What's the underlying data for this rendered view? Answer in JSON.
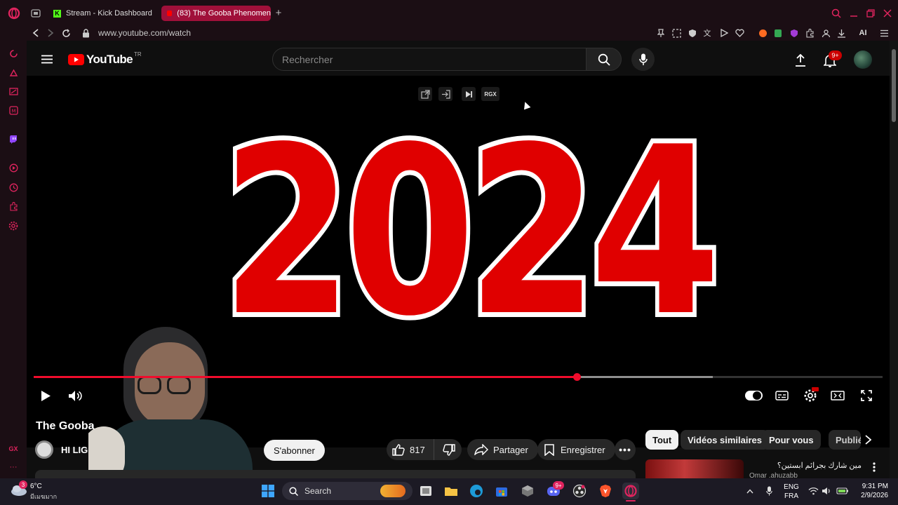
{
  "browser": {
    "tabs": [
      {
        "label": "Stream - Kick Dashboard",
        "active": false
      },
      {
        "label": "(83) The Gooba Phenomen",
        "active": true
      }
    ],
    "new_tab_icon": "plus-icon",
    "url": "www.youtube.com/watch",
    "ai_label": "AI"
  },
  "youtube": {
    "logo_text": "YouTube",
    "logo_country": "TR",
    "search_placeholder": "Rechercher",
    "notifications_badge": "9+",
    "player_overlay": {
      "rgx_label": "RGX"
    },
    "video_text": "2024",
    "progress": {
      "played_fraction": 0.64,
      "buffered_fraction": 0.8
    },
    "title_partial": "The Gooba",
    "channel_partial": "HI LIG",
    "subscribe_label": "S'abonner",
    "like_count": "817",
    "share_label": "Partager",
    "save_label": "Enregistrer",
    "chips": [
      "Tout",
      "Vidéos similaires",
      "Pour vous",
      "Publié"
    ],
    "related": {
      "title": "مين شارك بجرائم ابستين؟",
      "channel": "Omar .ahuzabb"
    },
    "sidebar_gx_label": "GX"
  },
  "taskbar": {
    "weather_temp": "6°C",
    "weather_desc": "มีเมฆมาก",
    "weather_badge": "3",
    "search_label": "Search",
    "lang_top": "ENG",
    "lang_bottom": "FRA",
    "time": "9:31 PM",
    "date": "2/9/2026",
    "discord_badge": "9+"
  },
  "colors": {
    "opera_accent": "#e0245e",
    "youtube_red": "#ff0000",
    "progress_red": "#f00c2c"
  }
}
